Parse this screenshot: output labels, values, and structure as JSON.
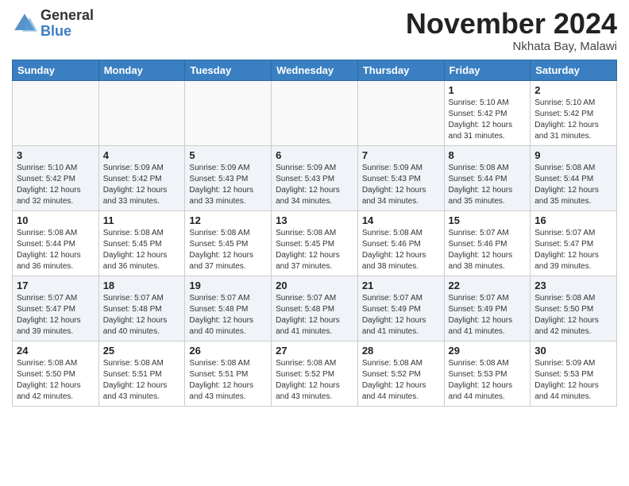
{
  "header": {
    "logo_general": "General",
    "logo_blue": "Blue",
    "month_year": "November 2024",
    "location": "Nkhata Bay, Malawi"
  },
  "days_of_week": [
    "Sunday",
    "Monday",
    "Tuesday",
    "Wednesday",
    "Thursday",
    "Friday",
    "Saturday"
  ],
  "weeks": [
    [
      {
        "day": "",
        "info": ""
      },
      {
        "day": "",
        "info": ""
      },
      {
        "day": "",
        "info": ""
      },
      {
        "day": "",
        "info": ""
      },
      {
        "day": "",
        "info": ""
      },
      {
        "day": "1",
        "info": "Sunrise: 5:10 AM\nSunset: 5:42 PM\nDaylight: 12 hours\nand 31 minutes."
      },
      {
        "day": "2",
        "info": "Sunrise: 5:10 AM\nSunset: 5:42 PM\nDaylight: 12 hours\nand 31 minutes."
      }
    ],
    [
      {
        "day": "3",
        "info": "Sunrise: 5:10 AM\nSunset: 5:42 PM\nDaylight: 12 hours\nand 32 minutes."
      },
      {
        "day": "4",
        "info": "Sunrise: 5:09 AM\nSunset: 5:42 PM\nDaylight: 12 hours\nand 33 minutes."
      },
      {
        "day": "5",
        "info": "Sunrise: 5:09 AM\nSunset: 5:43 PM\nDaylight: 12 hours\nand 33 minutes."
      },
      {
        "day": "6",
        "info": "Sunrise: 5:09 AM\nSunset: 5:43 PM\nDaylight: 12 hours\nand 34 minutes."
      },
      {
        "day": "7",
        "info": "Sunrise: 5:09 AM\nSunset: 5:43 PM\nDaylight: 12 hours\nand 34 minutes."
      },
      {
        "day": "8",
        "info": "Sunrise: 5:08 AM\nSunset: 5:44 PM\nDaylight: 12 hours\nand 35 minutes."
      },
      {
        "day": "9",
        "info": "Sunrise: 5:08 AM\nSunset: 5:44 PM\nDaylight: 12 hours\nand 35 minutes."
      }
    ],
    [
      {
        "day": "10",
        "info": "Sunrise: 5:08 AM\nSunset: 5:44 PM\nDaylight: 12 hours\nand 36 minutes."
      },
      {
        "day": "11",
        "info": "Sunrise: 5:08 AM\nSunset: 5:45 PM\nDaylight: 12 hours\nand 36 minutes."
      },
      {
        "day": "12",
        "info": "Sunrise: 5:08 AM\nSunset: 5:45 PM\nDaylight: 12 hours\nand 37 minutes."
      },
      {
        "day": "13",
        "info": "Sunrise: 5:08 AM\nSunset: 5:45 PM\nDaylight: 12 hours\nand 37 minutes."
      },
      {
        "day": "14",
        "info": "Sunrise: 5:08 AM\nSunset: 5:46 PM\nDaylight: 12 hours\nand 38 minutes."
      },
      {
        "day": "15",
        "info": "Sunrise: 5:07 AM\nSunset: 5:46 PM\nDaylight: 12 hours\nand 38 minutes."
      },
      {
        "day": "16",
        "info": "Sunrise: 5:07 AM\nSunset: 5:47 PM\nDaylight: 12 hours\nand 39 minutes."
      }
    ],
    [
      {
        "day": "17",
        "info": "Sunrise: 5:07 AM\nSunset: 5:47 PM\nDaylight: 12 hours\nand 39 minutes."
      },
      {
        "day": "18",
        "info": "Sunrise: 5:07 AM\nSunset: 5:48 PM\nDaylight: 12 hours\nand 40 minutes."
      },
      {
        "day": "19",
        "info": "Sunrise: 5:07 AM\nSunset: 5:48 PM\nDaylight: 12 hours\nand 40 minutes."
      },
      {
        "day": "20",
        "info": "Sunrise: 5:07 AM\nSunset: 5:48 PM\nDaylight: 12 hours\nand 41 minutes."
      },
      {
        "day": "21",
        "info": "Sunrise: 5:07 AM\nSunset: 5:49 PM\nDaylight: 12 hours\nand 41 minutes."
      },
      {
        "day": "22",
        "info": "Sunrise: 5:07 AM\nSunset: 5:49 PM\nDaylight: 12 hours\nand 41 minutes."
      },
      {
        "day": "23",
        "info": "Sunrise: 5:08 AM\nSunset: 5:50 PM\nDaylight: 12 hours\nand 42 minutes."
      }
    ],
    [
      {
        "day": "24",
        "info": "Sunrise: 5:08 AM\nSunset: 5:50 PM\nDaylight: 12 hours\nand 42 minutes."
      },
      {
        "day": "25",
        "info": "Sunrise: 5:08 AM\nSunset: 5:51 PM\nDaylight: 12 hours\nand 43 minutes."
      },
      {
        "day": "26",
        "info": "Sunrise: 5:08 AM\nSunset: 5:51 PM\nDaylight: 12 hours\nand 43 minutes."
      },
      {
        "day": "27",
        "info": "Sunrise: 5:08 AM\nSunset: 5:52 PM\nDaylight: 12 hours\nand 43 minutes."
      },
      {
        "day": "28",
        "info": "Sunrise: 5:08 AM\nSunset: 5:52 PM\nDaylight: 12 hours\nand 44 minutes."
      },
      {
        "day": "29",
        "info": "Sunrise: 5:08 AM\nSunset: 5:53 PM\nDaylight: 12 hours\nand 44 minutes."
      },
      {
        "day": "30",
        "info": "Sunrise: 5:09 AM\nSunset: 5:53 PM\nDaylight: 12 hours\nand 44 minutes."
      }
    ]
  ]
}
